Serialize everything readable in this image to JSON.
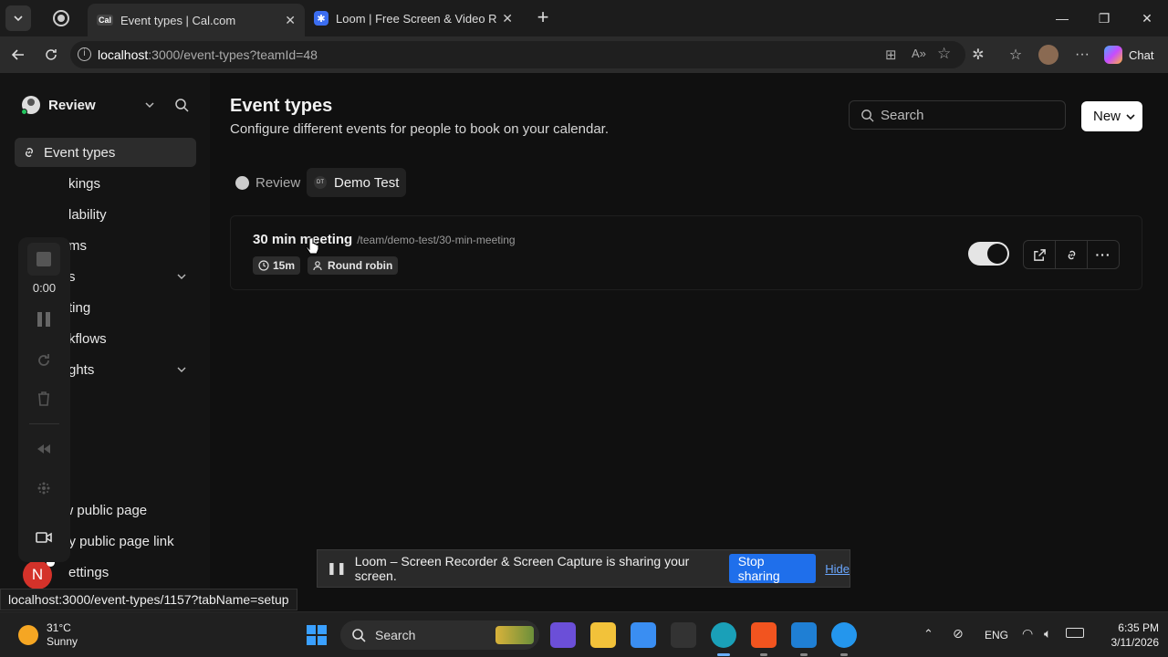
{
  "browser": {
    "tabs": [
      {
        "title": "Event types | Cal.com",
        "favicon": "Cal",
        "active": true
      },
      {
        "title": "Loom | Free Screen & Video Recor",
        "active": false
      }
    ],
    "url_host": "localhost",
    "url_path": ":3000/event-types?teamId=48",
    "profile_chat": "Chat"
  },
  "sidebar": {
    "user": "Review",
    "items": [
      {
        "label": "Event types",
        "active": true
      },
      {
        "label": "kings"
      },
      {
        "label": "lability"
      },
      {
        "label": "ms"
      },
      {
        "label": "s"
      },
      {
        "label": "ting"
      },
      {
        "label": "kflows"
      },
      {
        "label": "ghts"
      }
    ],
    "bottom": [
      {
        "label": "View public page"
      },
      {
        "label": "Copy public page link"
      },
      {
        "label": "ettings"
      }
    ],
    "avatar_letter": "N"
  },
  "loom": {
    "timer": "0:00"
  },
  "header": {
    "title": "Event types",
    "subtitle": "Configure different events for people to book on your calendar.",
    "search_placeholder": "Search",
    "new_label": "New"
  },
  "filters": [
    {
      "label": "Review",
      "active": false
    },
    {
      "label": "Demo Test",
      "active": true,
      "badge": "DT"
    }
  ],
  "event": {
    "title": "30 min meeting",
    "slug": "/team/demo-test/30-min-meeting",
    "duration": "15m",
    "scheduling": "Round robin",
    "enabled": true
  },
  "share_bar": {
    "message": "Loom – Screen Recorder & Screen Capture is sharing your screen.",
    "stop_label": "Stop sharing",
    "hide_label": "Hide"
  },
  "status_url": "localhost:3000/event-types/1157?tabName=setup",
  "taskbar": {
    "weather_temp": "31°C",
    "weather_desc": "Sunny",
    "search_label": "Search",
    "lang": "ENG",
    "time": "6:35 PM",
    "date": "3/11/2026"
  },
  "colors": {
    "accent": "#1f6feb",
    "bg": "#101010"
  }
}
